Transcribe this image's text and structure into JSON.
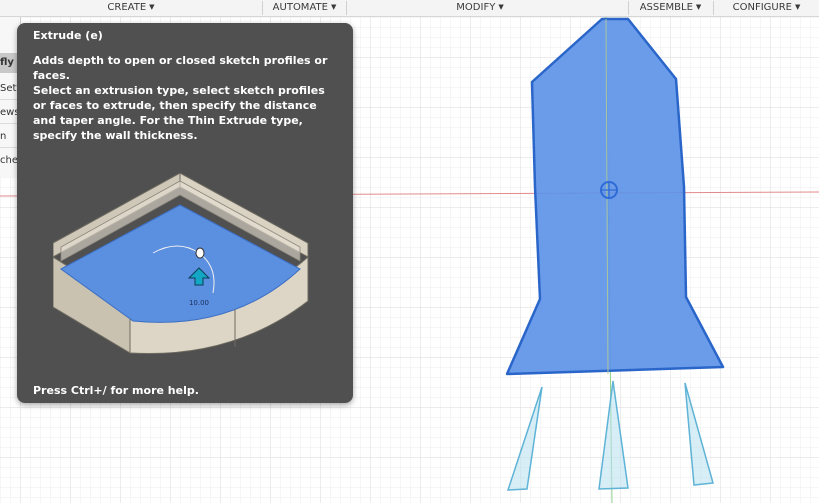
{
  "toolbar": {
    "create": "CREATE",
    "automate": "AUTOMATE",
    "modify": "MODIFY",
    "assemble": "ASSEMBLE",
    "configure": "CONFIGURE",
    "caret": "▼"
  },
  "browser": {
    "rows": [
      "fly",
      "Setti",
      "ews",
      "n",
      "ches"
    ]
  },
  "tooltip": {
    "title": "Extrude (e)",
    "description": "Adds depth to open or closed sketch profiles or faces.",
    "body": "Select an extrusion type, select sketch profiles or faces to extrude, then specify the distance and taper angle. For the Thin Extrude type, specify the wall thickness.",
    "illustration_value": "10.00",
    "footer": "Press Ctrl+/ for more help."
  },
  "colors": {
    "tooltip_bg": "#505050",
    "profile_fill": "#5b91e8",
    "profile_stroke": "#2a66c9",
    "grid_line": "#e2e2e2",
    "axis_red": "#e08080",
    "axis_green": "#8fcf8f"
  }
}
